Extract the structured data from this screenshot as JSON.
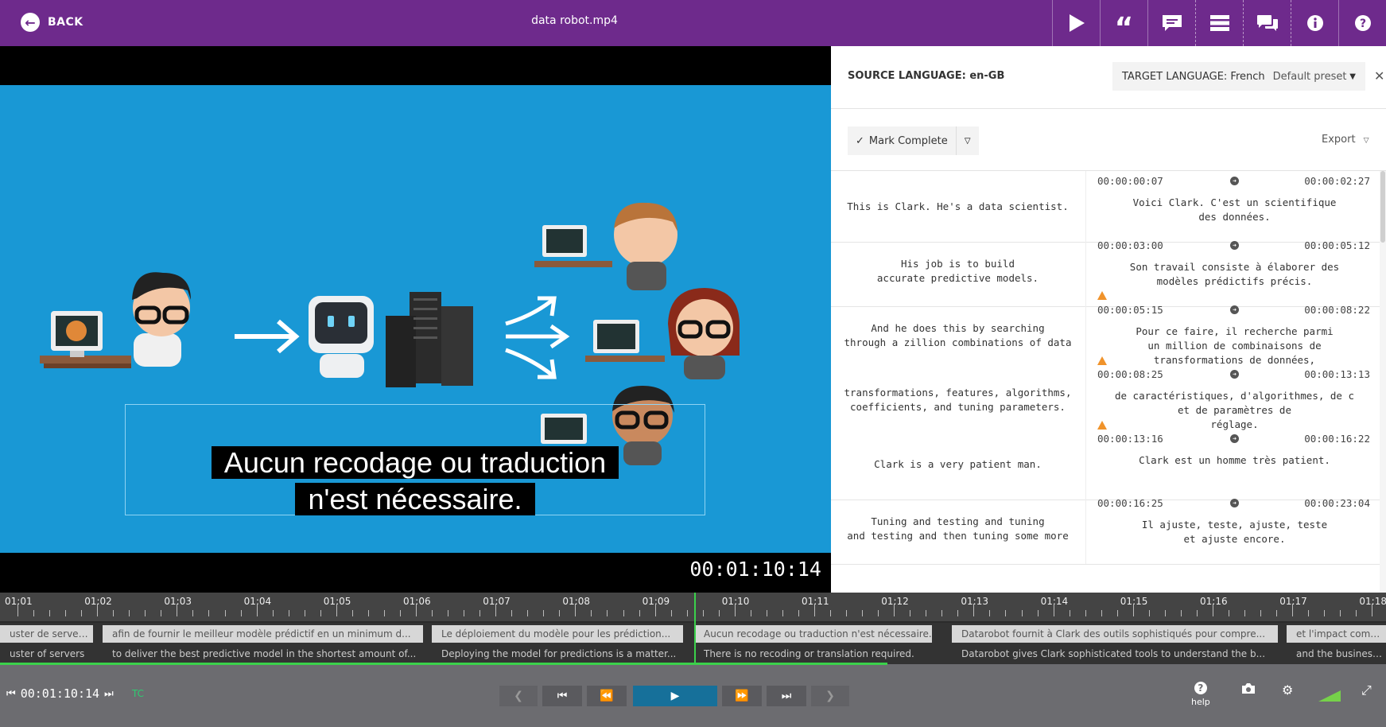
{
  "topbar": {
    "back_label": "BACK",
    "title": "data robot.mp4",
    "tools": [
      "play-icon",
      "quote-icon",
      "message-icon",
      "rows-icon",
      "chat-icon",
      "info-icon",
      "help-icon"
    ]
  },
  "video": {
    "subtitle_line1": "Aucun recodage ou traduction",
    "subtitle_line2": "n'est nécessaire.",
    "timecode": "00:01:10:14"
  },
  "panel": {
    "source_language": "SOURCE LANGUAGE: en-GB",
    "target_language": "TARGET LANGUAGE: French",
    "preset": "Default preset",
    "mark_complete": "Mark Complete",
    "export": "Export",
    "cues": [
      {
        "source": "This is Clark. He's a data scientist.",
        "in": "00:00:00:07",
        "out": "00:00:02:27",
        "target": "Voici Clark. C'est un scientifique\ndes données.",
        "warning": false
      },
      {
        "source": "His job is to build\naccurate predictive models.",
        "in": "00:00:03:00",
        "out": "00:00:05:12",
        "target": "Son travail consiste à élaborer des\nmodèles prédictifs précis.",
        "warning": true
      },
      {
        "source": "And he does this by searching\nthrough a zillion combinations of data",
        "in": "00:00:05:15",
        "out": "00:00:08:22",
        "target": "Pour ce faire, il recherche parmi\nun million de combinaisons de\ntransformations de données,",
        "warning": true
      },
      {
        "source": "transformations, features, algorithms,\ncoefficients, and tuning parameters.",
        "in": "00:00:08:25",
        "out": "00:00:13:13",
        "target": "de caractéristiques, d'algorithmes, de c\net de paramètres de\nréglage.",
        "warning": true
      },
      {
        "source": "Clark is a very patient man.",
        "in": "00:00:13:16",
        "out": "00:00:16:22",
        "target": "Clark est un homme très patient.",
        "warning": false
      },
      {
        "source": "Tuning and testing and tuning\nand testing and then tuning some more",
        "in": "00:00:16:25",
        "out": "00:00:23:04",
        "target": "Il ajuste, teste, ajuste, teste\net ajuste encore.",
        "warning": false
      }
    ]
  },
  "timeline": {
    "ticks": [
      "01:01",
      "01:02",
      "01:03",
      "01:04",
      "01:05",
      "01:06",
      "01:07",
      "01:08",
      "01:09",
      "01:10",
      "01:11",
      "01:12",
      "01:13",
      "01:14",
      "01:15",
      "01:16",
      "01:17",
      "01:18"
    ],
    "french_segments": [
      "uster de serveurs",
      "afin de fournir le meilleur modèle prédictif en un minimum d...",
      "Le déploiement du modèle pour les prédiction...",
      "Aucun recodage ou traduction n'est nécessaire.",
      "Datarobot fournit à Clark des outils sophistiqués pour compre...",
      "et l'impact commer"
    ],
    "english_segments": [
      "uster of servers",
      "to deliver the best predictive model in the shortest amount of...",
      "Deploying the model for predictions is a matter...",
      "There is no recoding or translation required.",
      "Datarobot gives Clark sophisticated tools to understand the b...",
      "and the business im"
    ],
    "playback_progress": 0.64
  },
  "controls": {
    "timecode": "00:01:10:14",
    "tc_tag": "TC",
    "help_label": "help"
  }
}
